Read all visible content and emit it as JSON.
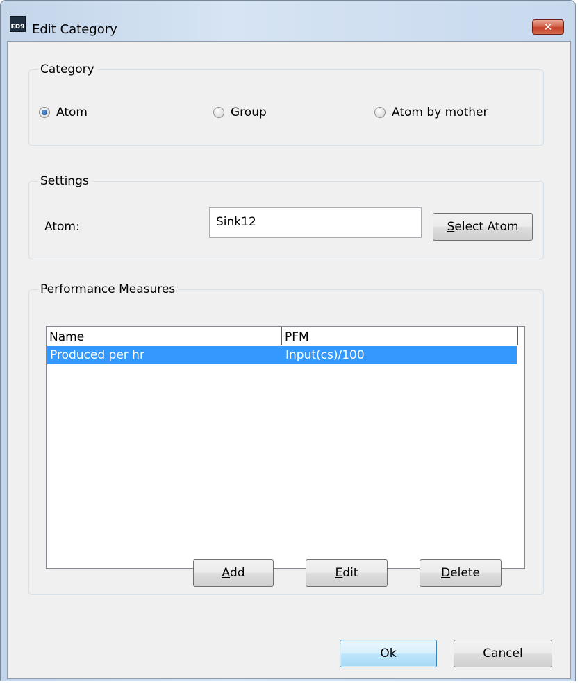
{
  "window": {
    "title": "Edit Category",
    "app_icon_text": "ED9",
    "close_glyph": "✕"
  },
  "category": {
    "label": "Category",
    "options": [
      {
        "label": "Atom",
        "checked": true
      },
      {
        "label": "Group",
        "checked": false
      },
      {
        "label": "Atom by mother",
        "checked": false
      }
    ]
  },
  "settings": {
    "label": "Settings",
    "atom_label": "Atom:",
    "atom_value": "Sink12",
    "select_button": {
      "mnemonic": "S",
      "rest": "elect Atom"
    }
  },
  "performance": {
    "label": "Performance Measures",
    "columns": [
      "Name",
      "PFM"
    ],
    "rows": [
      {
        "name": "Produced per hr",
        "pfm": "Input(cs)/100",
        "selected": true
      }
    ],
    "buttons": {
      "add": {
        "mnemonic": "A",
        "rest": "dd"
      },
      "edit": {
        "mnemonic": "E",
        "rest": "dit"
      },
      "delete": {
        "mnemonic": "D",
        "rest": "elete"
      }
    }
  },
  "footer": {
    "ok": {
      "mnemonic": "O",
      "rest": "k"
    },
    "cancel": {
      "mnemonic": "C",
      "rest": "ancel"
    }
  },
  "colors": {
    "selection": "#3399ff",
    "close": "#c4402a",
    "frame": "#c4d5ea"
  }
}
